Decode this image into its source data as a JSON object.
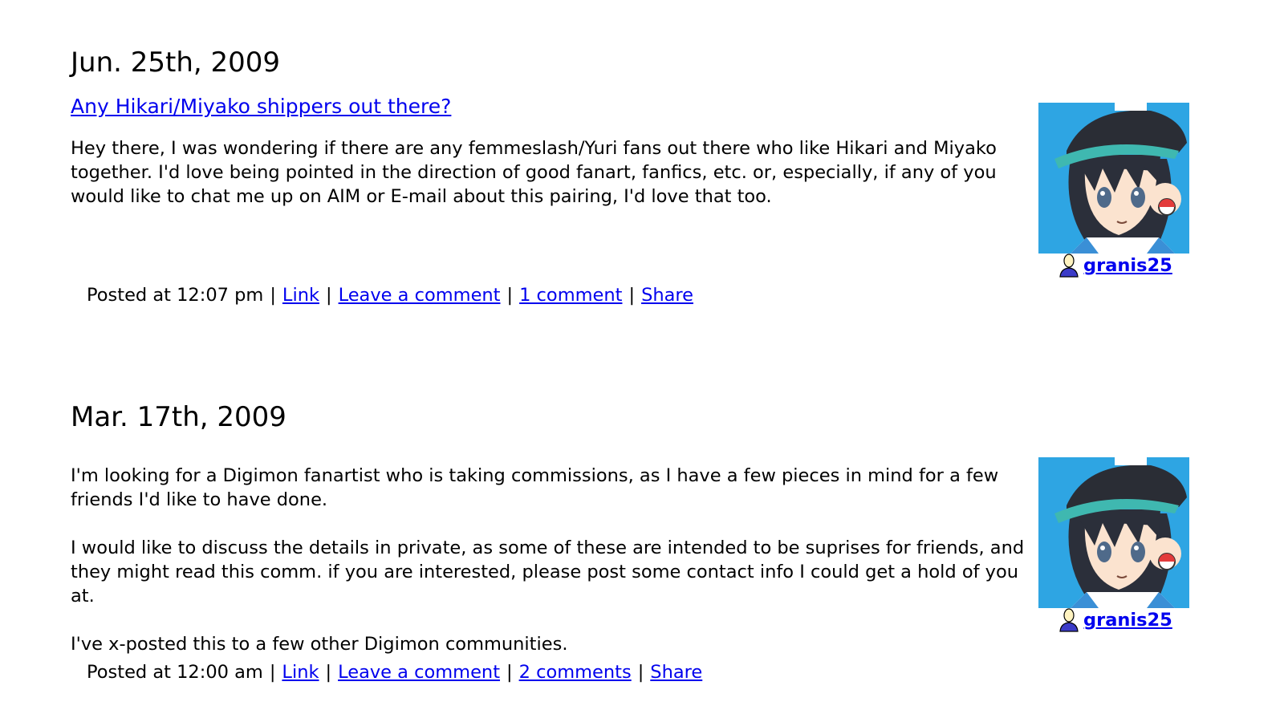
{
  "posts": [
    {
      "date": "Jun. 25th, 2009",
      "title": "Any Hikari/Miyako shippers out there?",
      "paragraphs": [
        "Hey there, I was wondering if there are any femmeslash/Yuri fans out there who like Hikari and Miyako together. I'd love being pointed in the direction of good fanart, fanfics, etc. or, especially, if any of you would like to chat me up on AIM or E-mail about this pairing, I'd love that too."
      ],
      "poster": "granis25",
      "userpic_icon": "trainer-avatar-icon",
      "meta": {
        "posted": "Posted at 12:07 pm",
        "link": "Link",
        "leave_comment": "Leave a comment",
        "comments": "1 comment",
        "share": "Share"
      }
    },
    {
      "date": "Mar. 17th, 2009",
      "title": "",
      "paragraphs": [
        "I'm looking for a Digimon fanartist who is taking commissions, as I have a few pieces in mind for a few friends I'd like to have done.",
        "I would like to discuss the details in private, as some of these are intended to be suprises for friends, and they might read this comm. if you are interested, please post some contact info I could get a hold of you at.",
        "I've x-posted this to a few other Digimon communities."
      ],
      "poster": "granis25",
      "userpic_icon": "trainer-avatar-icon",
      "meta": {
        "posted": "Posted at 12:00 am",
        "link": "Link",
        "leave_comment": "Leave a comment",
        "comments": "2 comments",
        "share": "Share"
      }
    }
  ],
  "colors": {
    "link": "#0000ee",
    "userpic_bg": "#2ea5e3"
  }
}
